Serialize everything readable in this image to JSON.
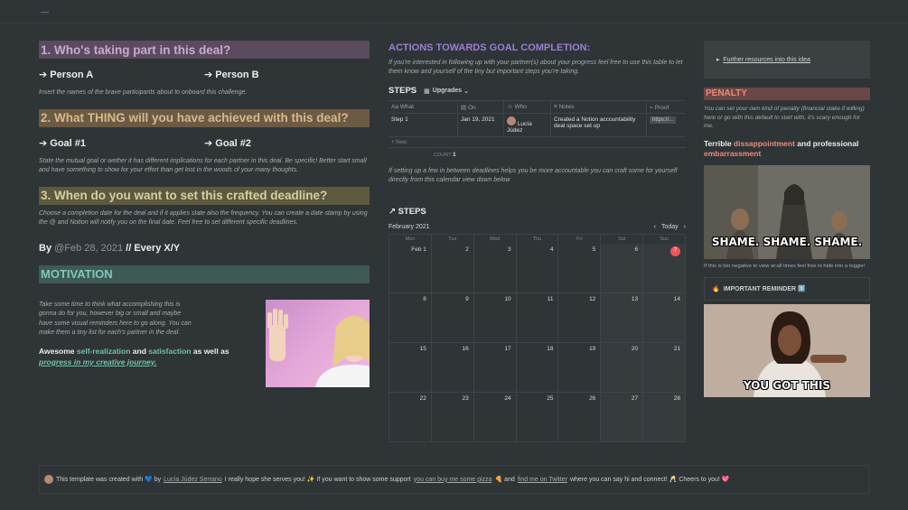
{
  "topbar": {
    "mark": "—"
  },
  "left": {
    "q1": "1. Who's taking part in this deal?",
    "personA": "➔ Person A",
    "personB": "➔ Person B",
    "q1_note": "Insert the names of the brave participants about to onboard this challenge.",
    "q2": "2. What THING will you have achieved with this deal?",
    "goal1": "➔ Goal #1",
    "goal2": "➔ Goal #2",
    "q2_note": "State the mutual goal or wether it has different implications for each partner in this deal. Be specific! Better start small and have something to show for your effort than get lost in the woods of your many thoughts.",
    "q3": "3. When do you want to set this crafted deadline?",
    "q3_note": "Choose a completion date for the deal and if it applies state also the frequency. You can create a date stamp by using the @ and Notion will notify you on the final date. Feel free to set different specific deadlines.",
    "by_prefix": "By ",
    "by_date": "@Feb 28, 2021",
    "by_suffix": " // Every X/Y",
    "motivation": "MOTIVATION",
    "motivation_note": "Take some time to think what accomplishing this is gonna do for you, however big or small and maybe have some visual reminders here to go along. You can make them a tiny list for each's partner in the deal.",
    "awesome_1": "Awesome ",
    "awesome_2": "self-realization",
    "awesome_3": " and ",
    "awesome_4": "satisfaction",
    "awesome_5": " as well as ",
    "awesome_6": "progress in my creative journey."
  },
  "mid": {
    "title": "ACTIONS TOWARDS GOAL COMPLETION:",
    "note": "If you're interested in following up with your partner(s) about your progress feel free to use this table to let them know and yourself of the tiny but important steps you're taking.",
    "steps_label": "STEPS",
    "view_label": "Upgrades",
    "columns": [
      "What",
      "On",
      "Who",
      "Notes",
      "Proof"
    ],
    "row": {
      "what": "Step 1",
      "on": "Jan 19, 2021",
      "who": "Lucía Júdez",
      "notes": "Created a Notion accountability deal space set up",
      "proof": "https://..."
    },
    "new_label": "+  New",
    "count_label": "COUNT",
    "count_value": "1",
    "cal_note": "If setting up a few in between deadlines helps you be more accountable you can craft some for yourself directly from this calendar view down below",
    "cal_title": "↗ STEPS",
    "month": "February 2021",
    "today_label": "Today",
    "days": [
      "Mon",
      "Tue",
      "Wed",
      "Thu",
      "Fri",
      "Sat",
      "Sun"
    ],
    "weeks": [
      [
        "Feb 1",
        "2",
        "3",
        "4",
        "5",
        "6",
        "7"
      ],
      [
        "8",
        "9",
        "10",
        "11",
        "12",
        "13",
        "14"
      ],
      [
        "15",
        "16",
        "17",
        "18",
        "19",
        "20",
        "21"
      ],
      [
        "22",
        "23",
        "24",
        "25",
        "26",
        "27",
        "28"
      ]
    ],
    "today_day": "7"
  },
  "right": {
    "toggle": "Further resources into this idea",
    "penalty": "PENALTY",
    "penalty_note": "You can set your own kind of penalty (financial stake if willing) here or go with this default to start with, it's scary enough for me.",
    "terrible_1": "Terrible ",
    "terrible_2": "dissappointment",
    "terrible_3": " and professional ",
    "terrible_4": "embarrassment",
    "shame_text": "SHAME. SHAME. SHAME.",
    "neg_note": "If this is too negative to view at all times feel free to hide into a toggle!",
    "reminder": "IMPORTANT REMINDER 1️⃣",
    "gotthis_text": "YOU GOT THIS"
  },
  "footer": {
    "t1": "This template was created with 💙 by ",
    "author": "Lucía Júdez Serrano",
    "t2": " I really hope she serves you! ✨ If you want to show some support ",
    "pizza": "you can buy me some pizza",
    "t3": " 🍕 and ",
    "twitter": "find me on Twitter",
    "t4": " where you can say hi and connect! 🥂 Cheers to you! 💖"
  }
}
